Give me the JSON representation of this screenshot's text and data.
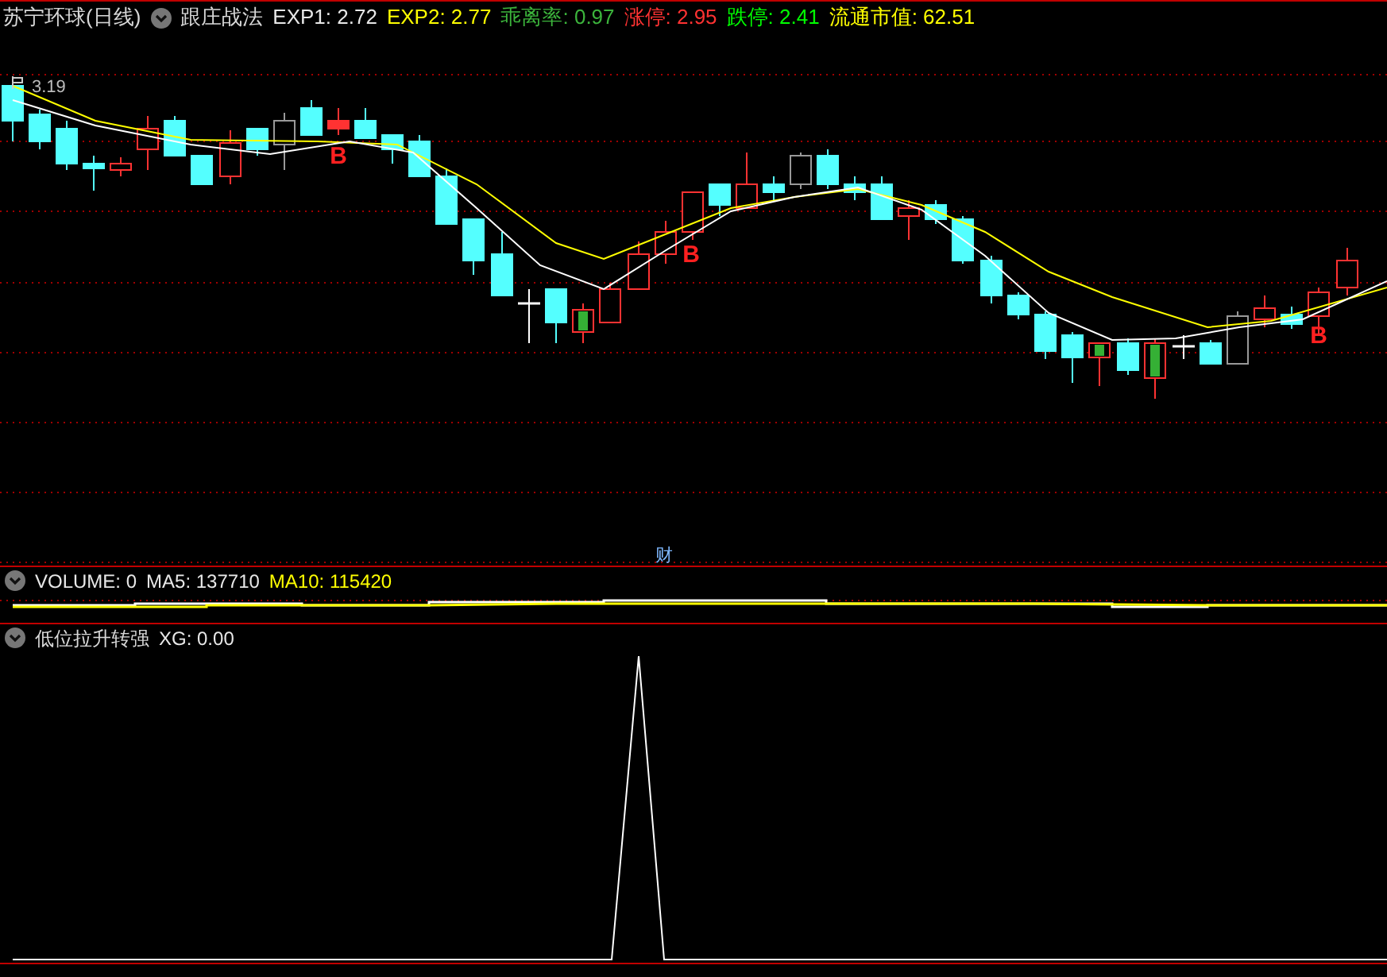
{
  "main_panel": {
    "stock_name": "苏宁环球(日线)",
    "indicator_name": "跟庄战法",
    "readouts": [
      {
        "text": "EXP1: 2.72",
        "color": "#e8e8e8"
      },
      {
        "text": "EXP2: 2.77",
        "color": "#ffff00"
      },
      {
        "text": "乖离率: 0.97",
        "color": "#3cb43c"
      },
      {
        "text": "涨停: 2.95",
        "color": "#ff3232"
      },
      {
        "text": "跌停: 2.41",
        "color": "#00ff00"
      },
      {
        "text": "流通市值: 62.51",
        "color": "#ffff00"
      }
    ],
    "price_label": "3.19",
    "signal_markers": [
      "B",
      "B",
      "B"
    ],
    "event_marker": "财"
  },
  "volume_panel": {
    "readouts": [
      {
        "text": "VOLUME: 0",
        "color": "#e8e8e8"
      },
      {
        "text": "MA5: 137710",
        "color": "#e8e8e8"
      },
      {
        "text": "MA10: 115420",
        "color": "#ffff00"
      }
    ]
  },
  "indicator_panel": {
    "title": "低位拉升转强",
    "readouts": [
      {
        "text": "XG: 0.00",
        "color": "#e8e8e8"
      }
    ]
  }
}
